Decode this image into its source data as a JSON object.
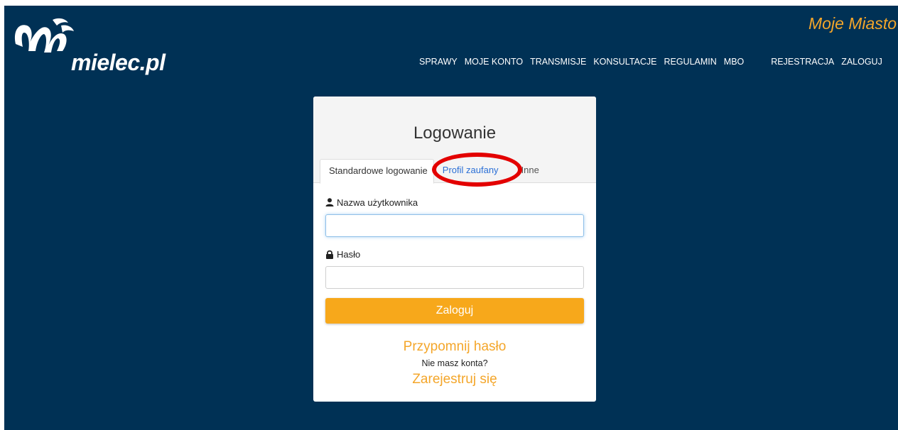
{
  "header": {
    "logo_text": "mielec.pl",
    "brand": "Moje Miasto",
    "nav": [
      "SPRAWY",
      "MOJE KONTO",
      "TRANSMISJE",
      "KONSULTACJE",
      "REGULAMIN",
      "MBO",
      "REJESTRACJA",
      "ZALOGUJ"
    ]
  },
  "login": {
    "title": "Logowanie",
    "tabs": [
      "Standardowe logowanie",
      "Profil zaufany",
      "Inne"
    ],
    "username_label": "Nazwa użytkownika",
    "username_value": "",
    "password_label": "Hasło",
    "password_value": "",
    "submit_label": "Zaloguj",
    "forgot_link": "Przypomnij hasło",
    "no_account": "Nie masz konta?",
    "register_link": "Zarejestruj się"
  },
  "colors": {
    "background": "#003155",
    "accent": "#f7a81b",
    "highlight": "#e30000",
    "tab_link": "#2a6fd6"
  },
  "icons": [
    "user-icon",
    "lock-icon"
  ]
}
